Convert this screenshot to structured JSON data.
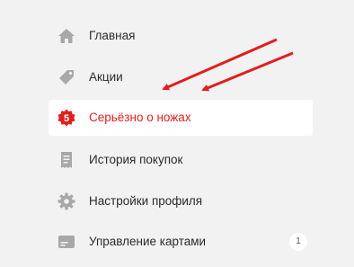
{
  "colors": {
    "background": "#f2f2f2",
    "icon": "#a8a8a8",
    "text": "#2b2b2b",
    "active_text": "#e01f1f",
    "active_background": "#ffffff",
    "arrow": "#e01f1f"
  },
  "menu": {
    "items": [
      {
        "label": "Главная",
        "icon": "home-icon"
      },
      {
        "label": "Акции",
        "icon": "tag-icon"
      },
      {
        "label": "Серьёзно о ножах",
        "icon": "badge-5-icon",
        "active": true,
        "icon_text": "5"
      },
      {
        "label": "История покупок",
        "icon": "receipt-icon"
      },
      {
        "label": "Настройки профиля",
        "icon": "gear-icon"
      },
      {
        "label": "Управление картами",
        "icon": "card-icon",
        "badge": "1"
      }
    ]
  }
}
